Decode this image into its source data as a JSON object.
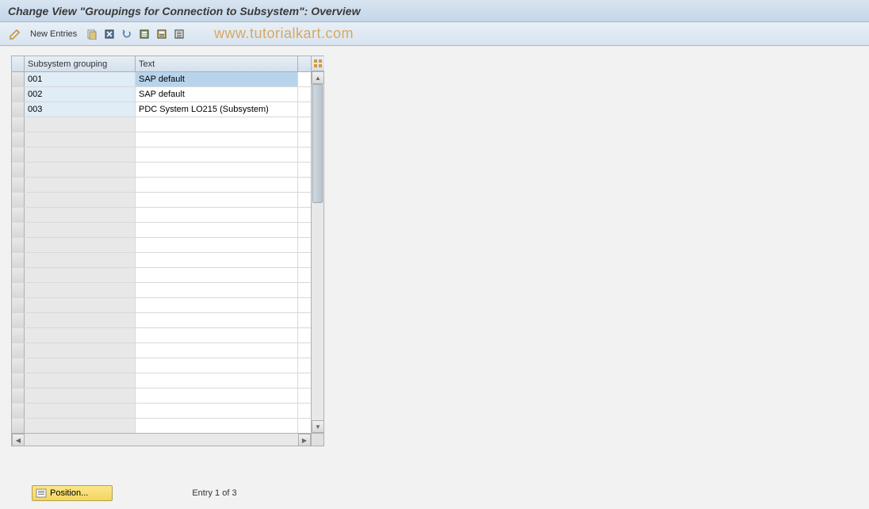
{
  "title": "Change View \"Groupings for Connection to Subsystem\": Overview",
  "toolbar": {
    "new_entries": "New Entries"
  },
  "watermark": "www.tutorialkart.com",
  "table": {
    "headers": {
      "subsystem": "Subsystem grouping",
      "text": "Text"
    },
    "rows": [
      {
        "id": "001",
        "text": "SAP default",
        "selected": true
      },
      {
        "id": "002",
        "text": "SAP default",
        "selected": false
      },
      {
        "id": "003",
        "text": "PDC System LO215 (Subsystem)",
        "selected": false
      }
    ]
  },
  "footer": {
    "position_label": "Position...",
    "entry_text": "Entry 1 of 3"
  }
}
